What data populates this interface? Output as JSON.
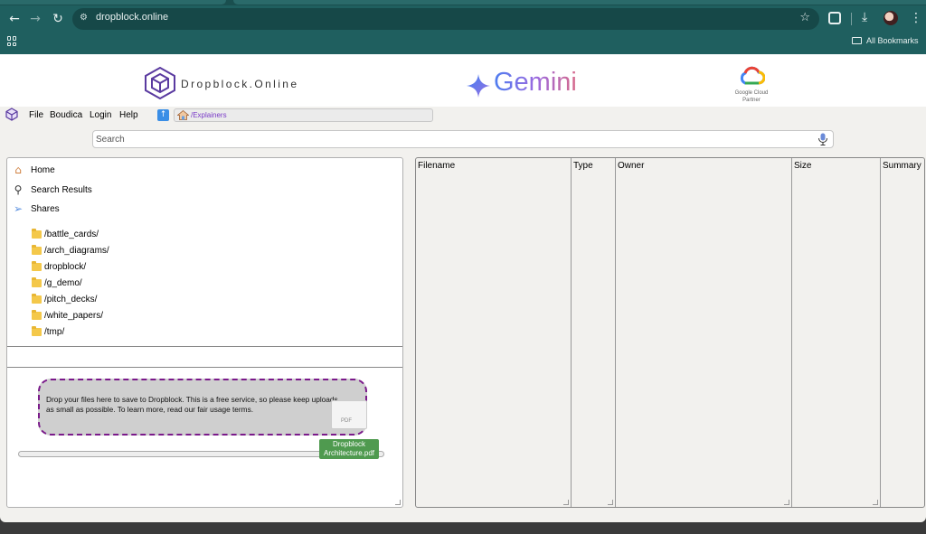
{
  "browser": {
    "url": "dropblock.online",
    "bookmarks_label": "All Bookmarks",
    "icons": [
      "back-icon",
      "forward-icon",
      "reload-icon",
      "site-info-icon",
      "star-icon",
      "extensions-icon",
      "download-icon",
      "menu-icon",
      "apps-icon"
    ]
  },
  "banner": {
    "title": "Dropblock.Online",
    "partner_brand": "Gemini",
    "cloud_label_line1": "Google Cloud",
    "cloud_label_line2": "Partner"
  },
  "menu": {
    "items": [
      "File",
      "Boudica",
      "Login",
      "Help"
    ],
    "path": "/Explainers"
  },
  "search": {
    "placeholder": "Search"
  },
  "sidebar": {
    "nav": [
      {
        "label": "Home",
        "icon": "home-icon"
      },
      {
        "label": "Search Results",
        "icon": "magnifier-icon"
      },
      {
        "label": "Shares",
        "icon": "paper-plane-icon"
      }
    ],
    "folders": [
      "/battle_cards/",
      "/arch_diagrams/",
      "dropblock/",
      "/g_demo/",
      "/pitch_decks/",
      "/white_papers/",
      "/tmp/"
    ]
  },
  "dropzone": {
    "text": "Drop your files here to save to Dropblock. This is a free service, so please keep uploads as small as possible. To learn more, read our fair usage terms.",
    "drag_file_label": "Dropblock Architecture.pdf",
    "drag_file_type": "PDF"
  },
  "table": {
    "columns": [
      "Filename",
      "Type",
      "Owner",
      "Size",
      "Summary"
    ]
  },
  "colors": {
    "browser_chrome": "#1f5f5f",
    "accent_purple": "#7a1a8a",
    "drag_label_green": "#4f9a4f",
    "folder_yellow": "#f4c84a"
  }
}
